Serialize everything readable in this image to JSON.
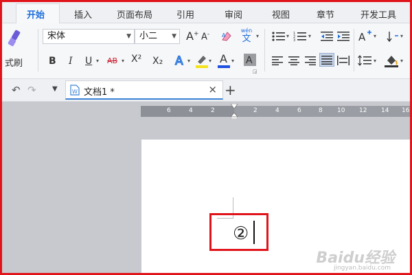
{
  "tabs": [
    "开始",
    "插入",
    "页面布局",
    "引用",
    "审阅",
    "视图",
    "章节",
    "开发工具"
  ],
  "ribbon": {
    "format_painter_label": "式刷",
    "font_name": "宋体",
    "font_size": "小二",
    "bold": "B",
    "italic": "I",
    "underline": "U",
    "strike": "AB",
    "superscript": "X²",
    "subscript": "X₂",
    "font_color_letter": "A",
    "phonetic": "wén",
    "phonetic_char": "文"
  },
  "document_tab": {
    "title": "文档1 *",
    "close": "×",
    "add": "+"
  },
  "ruler_ticks": [
    "6",
    "4",
    "2",
    "2",
    "2",
    "4",
    "6",
    "8",
    "10",
    "12",
    "14",
    "16"
  ],
  "document": {
    "content": "②"
  },
  "watermark": {
    "brand": "Baidu经验",
    "url": "jingyan.baidu.com"
  },
  "colors": {
    "highlight_border": "#e0131a",
    "accent": "#1f6fdb"
  }
}
